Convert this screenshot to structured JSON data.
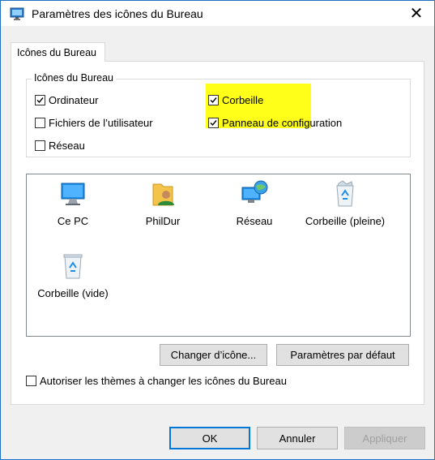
{
  "window": {
    "title": "Paramètres des icônes du Bureau",
    "close_glyph": "✕"
  },
  "tab": {
    "label": "Icônes du Bureau"
  },
  "group": {
    "legend": "Icônes du Bureau",
    "checkboxes": [
      {
        "label": "Ordinateur",
        "checked": true
      },
      {
        "label": "Corbeille",
        "checked": true,
        "highlighted": true
      },
      {
        "label": "Fichiers de l’utilisateur",
        "checked": false
      },
      {
        "label": "Panneau de configuration",
        "checked": true
      },
      {
        "label": "Réseau",
        "checked": false
      }
    ]
  },
  "icons": [
    {
      "label": "Ce PC",
      "icon": "computer-icon"
    },
    {
      "label": "PhilDur",
      "icon": "user-folder-icon"
    },
    {
      "label": "Réseau",
      "icon": "network-icon"
    },
    {
      "label": "Corbeille (pleine)",
      "icon": "recycle-bin-full-icon"
    },
    {
      "label": "Corbeille (vide)",
      "icon": "recycle-bin-empty-icon"
    }
  ],
  "buttons": {
    "change_icon": "Changer d’icône...",
    "default_settings": "Paramètres par défaut",
    "ok": "OK",
    "cancel": "Annuler",
    "apply": "Appliquer"
  },
  "allow_themes": {
    "label": "Autoriser les thèmes à changer les icônes du Bureau",
    "checked": false
  },
  "colors": {
    "highlight": "#ffff1a",
    "accent": "#0078d7",
    "border": "#1f6fc4"
  }
}
